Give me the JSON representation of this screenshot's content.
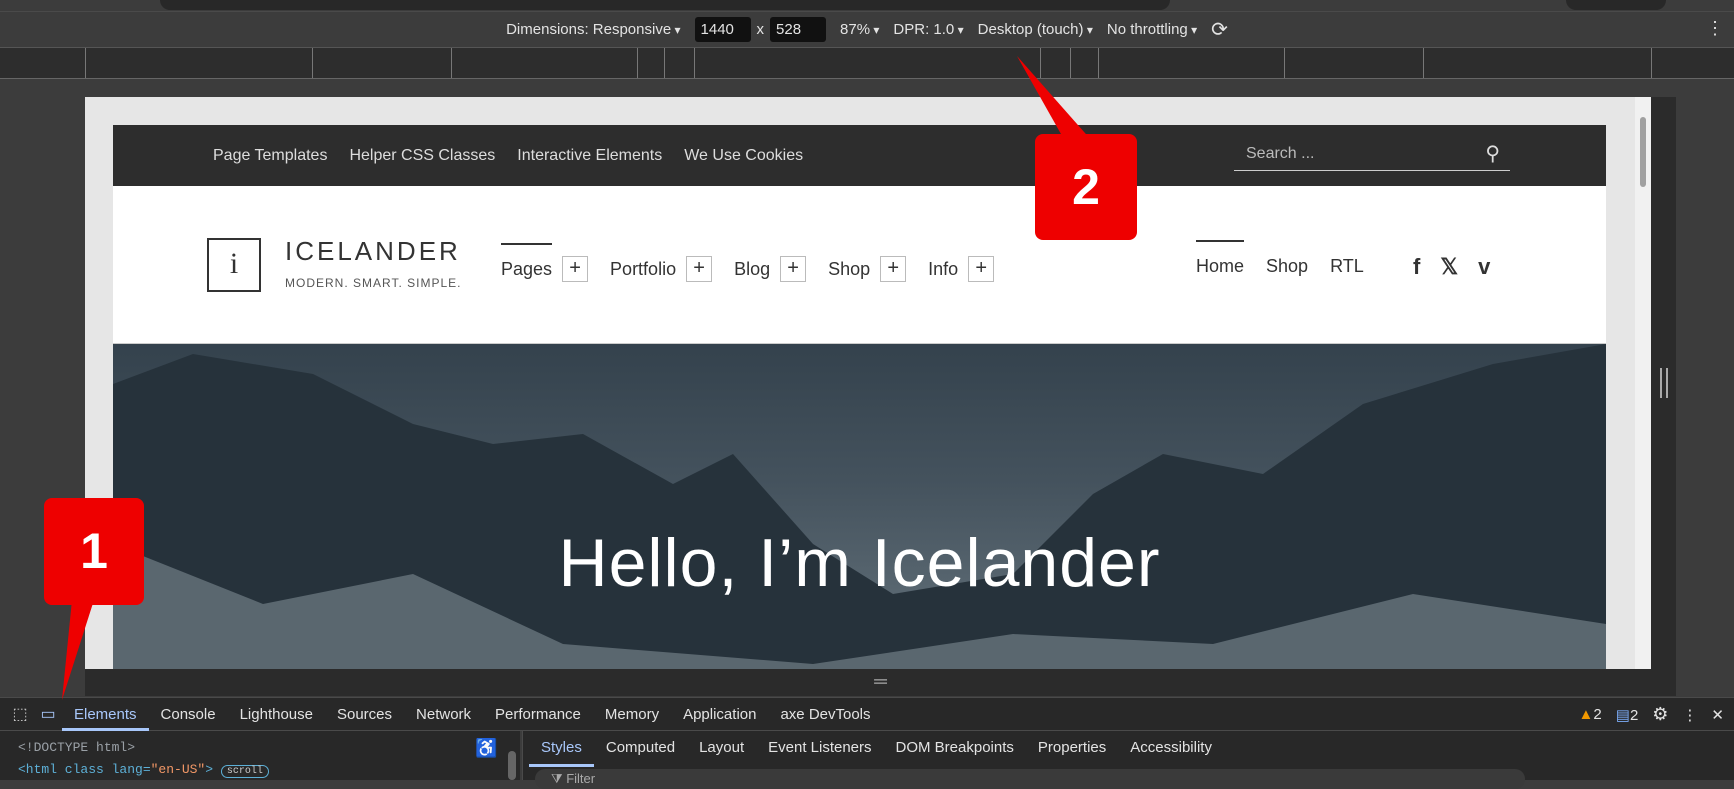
{
  "toolbar": {
    "dimensions": "Dimensions: Responsive",
    "width": "1440",
    "times": "x",
    "height": "528",
    "zoom": "87%",
    "dpr": "DPR: 1.0",
    "device": "Desktop (touch)",
    "throttling": "No throttling"
  },
  "site": {
    "top_nav": [
      "Page Templates",
      "Helper CSS Classes",
      "Interactive Elements",
      "We Use Cookies"
    ],
    "search_placeholder": "Search ...",
    "logo_letter": "i",
    "brand": "ICELANDER",
    "tagline": "MODERN. SMART. SIMPLE.",
    "main_nav": [
      "Pages",
      "Portfolio",
      "Blog",
      "Shop",
      "Info"
    ],
    "right_nav": [
      "Home",
      "Shop",
      "RTL"
    ],
    "social": [
      "facebook",
      "x",
      "vimeo"
    ],
    "hero_title": "Hello, I’m Icelander"
  },
  "devtools": {
    "tabs": [
      "Elements",
      "Console",
      "Lighthouse",
      "Sources",
      "Network",
      "Performance",
      "Memory",
      "Application",
      "axe DevTools"
    ],
    "warnings": "2",
    "messages": "2",
    "dom": {
      "doctype": "<!DOCTYPE html>",
      "html_open": "<html class lang=",
      "lang": "\"en-US\"",
      "close": ">",
      "badge": "scroll"
    },
    "style_tabs": [
      "Styles",
      "Computed",
      "Layout",
      "Event Listeners",
      "DOM Breakpoints",
      "Properties",
      "Accessibility"
    ],
    "filter": "Filter"
  },
  "callouts": [
    "1",
    "2"
  ],
  "colors": {
    "accent": "#a8c7fa",
    "callout": "#ee0000",
    "warning": "#f29900"
  }
}
